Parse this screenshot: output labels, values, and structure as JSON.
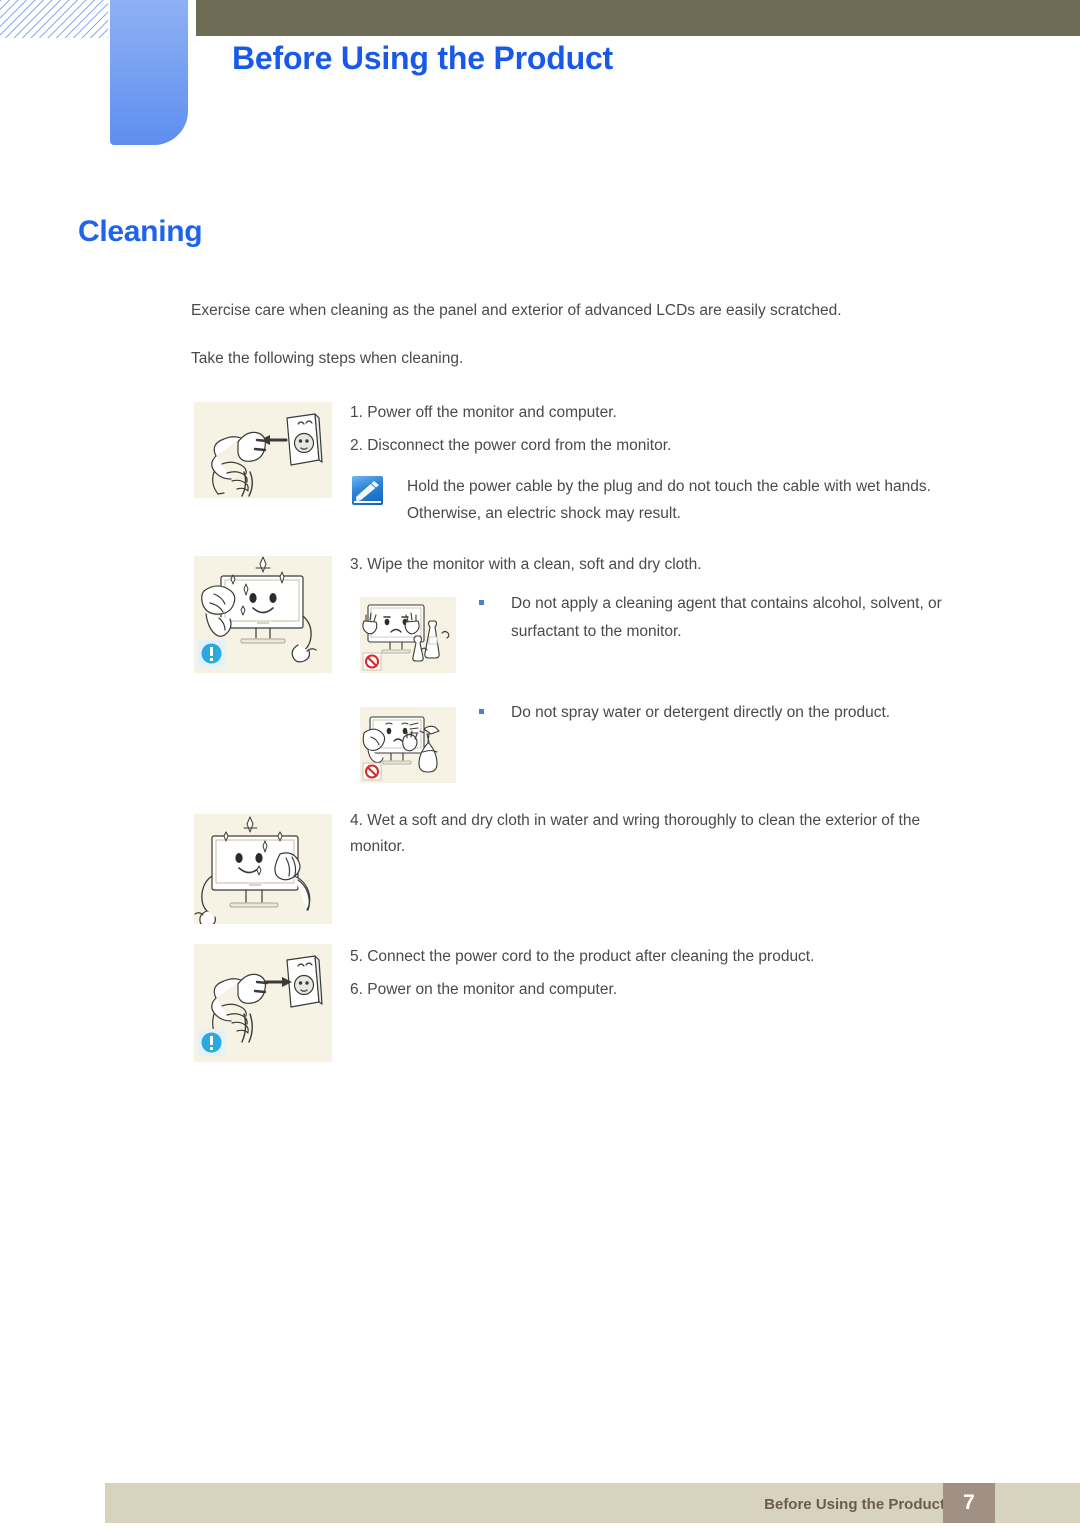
{
  "header": {
    "chapter_title": "Before Using the Product",
    "olive_bar_color": "#6e6b54",
    "tab_color": "#7aa2f2",
    "title_color": "#1959e8"
  },
  "section": {
    "heading": "Cleaning",
    "heading_color": "#1d63ec"
  },
  "intro": {
    "line1": "Exercise care when cleaning as the panel and exterior of advanced LCDs are easily scratched.",
    "line2": "Take the following steps when cleaning."
  },
  "steps": [
    {
      "id": 1,
      "text": "1. Power off the monitor and computer."
    },
    {
      "id": 2,
      "text": "2. Disconnect the power cord from the monitor."
    },
    {
      "id": 3,
      "text": "3. Wipe the monitor with a clean, soft and dry cloth."
    },
    {
      "id": 4,
      "text": "4. Wet a soft and dry cloth in water and wring thoroughly to clean the exterior of the monitor."
    },
    {
      "id": 5,
      "text": "5. Connect the power cord to the product after cleaning the product."
    },
    {
      "id": 6,
      "text": "6. Power on the monitor and computer."
    }
  ],
  "note": {
    "icon": "note-pencil-icon",
    "text": "Hold the power cable by the plug and do not touch the cable with wet hands. Otherwise, an electric shock may result."
  },
  "bullets": [
    {
      "text": "Do not apply a cleaning agent that contains alcohol, solvent, or surfactant to the monitor.",
      "bullet_color": "#4a7fd4"
    },
    {
      "text": "Do not spray water or detergent directly on the product.",
      "bullet_color": "#4a7fd4"
    }
  ],
  "illustrations": [
    {
      "name": "unplug-power-cord-illustration",
      "badge": "none"
    },
    {
      "name": "wipe-monitor-with-cloth-illustration",
      "badge": "caution-exclamation"
    },
    {
      "name": "no-cleaning-chemicals-illustration",
      "badge": "prohibited"
    },
    {
      "name": "no-spray-water-illustration",
      "badge": "prohibited"
    },
    {
      "name": "wet-cloth-clean-exterior-illustration",
      "badge": "none"
    },
    {
      "name": "plug-in-power-cord-illustration",
      "badge": "caution-exclamation"
    }
  ],
  "footer": {
    "label": "Before Using the Product",
    "page_number": "7",
    "bar_color": "#d8d3bf",
    "page_box_color": "#a09184"
  }
}
